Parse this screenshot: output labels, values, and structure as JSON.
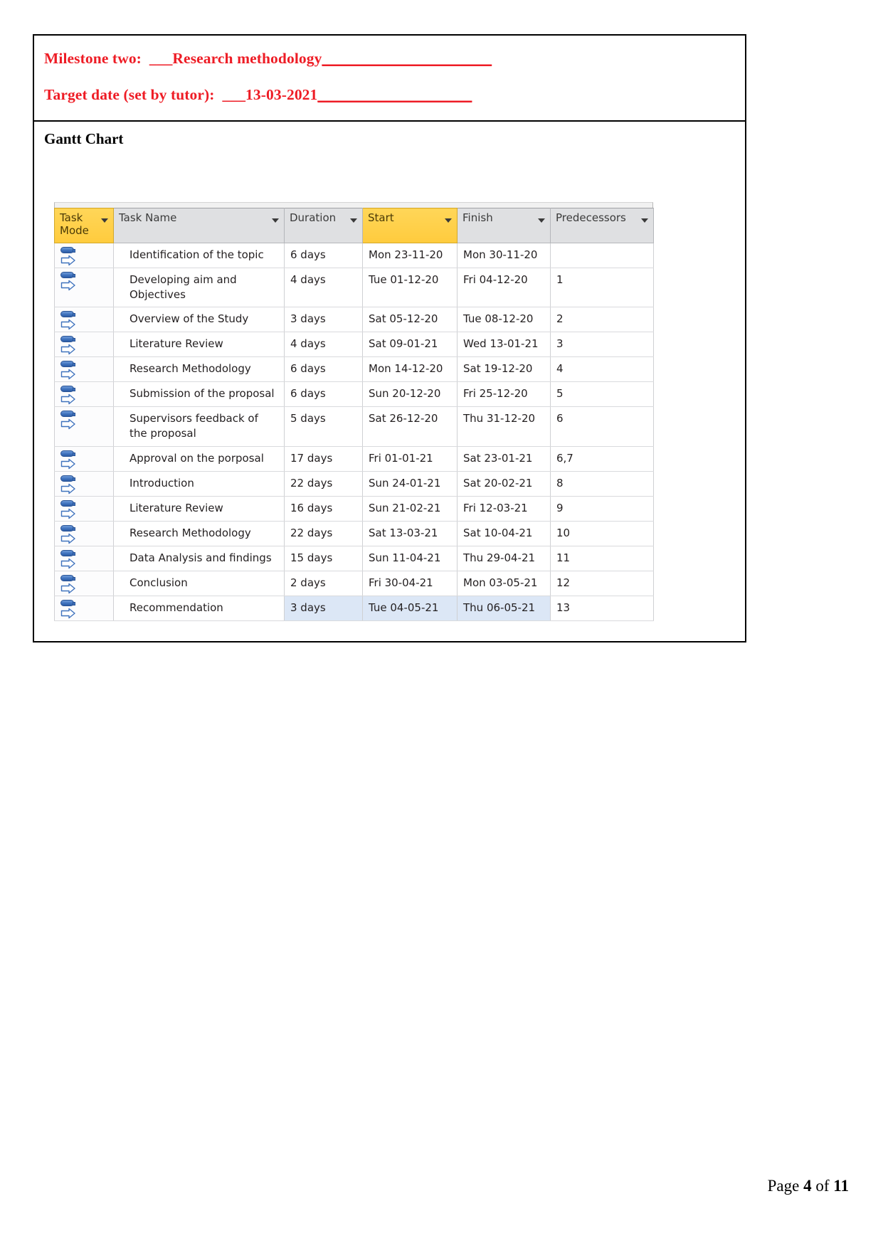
{
  "document": {
    "milestone_label": "Milestone two:  ___Research methodology",
    "milestone_rule": "______________________",
    "target_date_label": "Target date (set by tutor):  ___13-03-2021",
    "target_date_rule": "____________________",
    "section_title": "Gantt Chart",
    "footer": {
      "page_word": "Page ",
      "page_number": "4",
      "of_word": " of ",
      "total_pages": "11"
    }
  },
  "colors": {
    "milestone_red": "#ee1c25",
    "header_gray": "#dfe0e2",
    "header_highlight": "#ffd24d",
    "row_selection_blue": "#dce7f6",
    "icon_blue": "#3f72bd"
  },
  "chart_data": {
    "type": "table",
    "title": "Gantt Chart",
    "columns": [
      {
        "key": "mode",
        "label": "Task Mode",
        "highlighted": true
      },
      {
        "key": "name",
        "label": "Task Name",
        "highlighted": false
      },
      {
        "key": "duration",
        "label": "Duration",
        "highlighted": false
      },
      {
        "key": "start",
        "label": "Start",
        "highlighted": true
      },
      {
        "key": "finish",
        "label": "Finish",
        "highlighted": false
      },
      {
        "key": "predecessors",
        "label": "Predecessors",
        "highlighted": false
      }
    ],
    "rows": [
      {
        "id": 1,
        "mode_icon": "manually-scheduled-task-icon",
        "name": "Identification of the topic",
        "duration": "6 days",
        "start": "Mon 23-11-20",
        "finish": "Mon 30-11-20",
        "predecessors": "",
        "selected": false
      },
      {
        "id": 2,
        "mode_icon": "manually-scheduled-task-icon",
        "name": "Developing aim and Objectives",
        "duration": "4 days",
        "start": "Tue 01-12-20",
        "finish": "Fri 04-12-20",
        "predecessors": "1",
        "selected": false
      },
      {
        "id": 3,
        "mode_icon": "manually-scheduled-task-icon",
        "name": "Overview of the Study",
        "duration": "3 days",
        "start": "Sat 05-12-20",
        "finish": "Tue 08-12-20",
        "predecessors": "2",
        "selected": false
      },
      {
        "id": 4,
        "mode_icon": "manually-scheduled-task-icon",
        "name": "Literature Review",
        "duration": "4 days",
        "start": "Sat 09-01-21",
        "finish": "Wed 13-01-21",
        "predecessors": "3",
        "selected": false
      },
      {
        "id": 5,
        "mode_icon": "manually-scheduled-task-icon",
        "name": "Research Methodology",
        "duration": "6 days",
        "start": "Mon 14-12-20",
        "finish": "Sat 19-12-20",
        "predecessors": "4",
        "selected": false
      },
      {
        "id": 6,
        "mode_icon": "manually-scheduled-task-icon",
        "name": "Submission of the proposal",
        "duration": "6 days",
        "start": "Sun 20-12-20",
        "finish": "Fri 25-12-20",
        "predecessors": "5",
        "selected": false
      },
      {
        "id": 7,
        "mode_icon": "manually-scheduled-task-icon",
        "name": "Supervisors feedback of the proposal",
        "duration": "5 days",
        "start": "Sat 26-12-20",
        "finish": "Thu 31-12-20",
        "predecessors": "6",
        "selected": false
      },
      {
        "id": 8,
        "mode_icon": "manually-scheduled-task-icon",
        "name": "Approval on the porposal",
        "duration": "17 days",
        "start": "Fri 01-01-21",
        "finish": "Sat 23-01-21",
        "predecessors": "6,7",
        "selected": false
      },
      {
        "id": 9,
        "mode_icon": "manually-scheduled-task-icon",
        "name": "Introduction",
        "duration": "22 days",
        "start": "Sun 24-01-21",
        "finish": "Sat 20-02-21",
        "predecessors": "8",
        "selected": false
      },
      {
        "id": 10,
        "mode_icon": "manually-scheduled-task-icon",
        "name": "Literature Review",
        "duration": "16 days",
        "start": "Sun 21-02-21",
        "finish": "Fri 12-03-21",
        "predecessors": "9",
        "selected": false
      },
      {
        "id": 11,
        "mode_icon": "manually-scheduled-task-icon",
        "name": "Research Methodology",
        "duration": "22 days",
        "start": "Sat 13-03-21",
        "finish": "Sat 10-04-21",
        "predecessors": "10",
        "selected": false
      },
      {
        "id": 12,
        "mode_icon": "manually-scheduled-task-icon",
        "name": "Data Analysis and findings",
        "duration": "15 days",
        "start": "Sun 11-04-21",
        "finish": "Thu 29-04-21",
        "predecessors": "11",
        "selected": false
      },
      {
        "id": 13,
        "mode_icon": "manually-scheduled-task-icon",
        "name": "Conclusion",
        "duration": "2 days",
        "start": "Fri 30-04-21",
        "finish": "Mon 03-05-21",
        "predecessors": "12",
        "selected": false
      },
      {
        "id": 14,
        "mode_icon": "manually-scheduled-task-icon",
        "name": "Recommendation",
        "duration": "3 days",
        "start": "Tue 04-05-21",
        "finish": "Thu 06-05-21",
        "predecessors": "13",
        "selected": true
      }
    ]
  }
}
